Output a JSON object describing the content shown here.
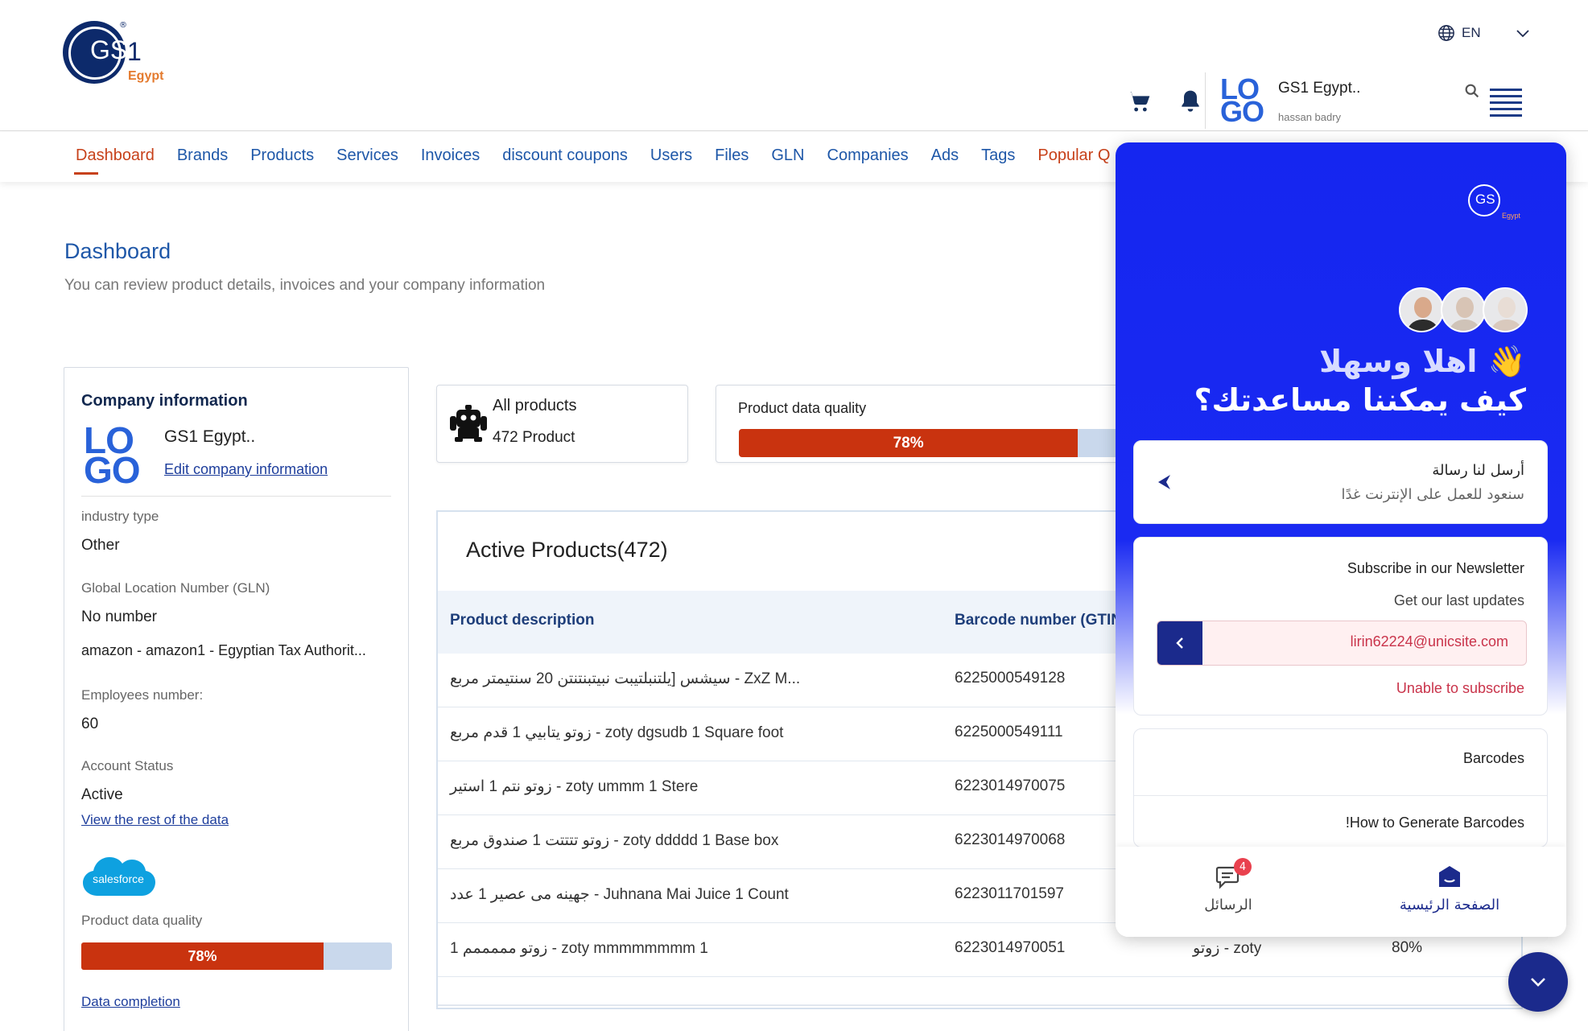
{
  "header": {
    "brand_gs": "GS",
    "brand_one": "1",
    "brand_reg": "®",
    "brand_region": "Egypt",
    "language": "EN",
    "logo_top": "LO",
    "logo_bottom": "GO",
    "user_company": "GS1 Egypt..",
    "user_name": "hassan badry"
  },
  "nav": {
    "items": [
      "Dashboard",
      "Brands",
      "Products",
      "Services",
      "Invoices",
      "discount coupons",
      "Users",
      "Files",
      "GLN",
      "Companies",
      "Ads",
      "Tags",
      "Popular Q"
    ]
  },
  "page": {
    "title": "Dashboard",
    "subtitle": "You can review product details, invoices and your company information"
  },
  "company": {
    "heading": "Company information",
    "name": "GS1 Egypt..",
    "edit_link": "Edit company information",
    "industry_label": "industry type",
    "industry_value": "Other",
    "gln_label": "Global Location Number (GLN)",
    "gln_value": "No number",
    "tax_value": "amazon - amazon1 - Egyptian Tax Authorit...",
    "employees_label": "Employees number:",
    "employees_value": "60",
    "status_label": "Account Status",
    "status_value": "Active",
    "rest_link": "View the rest of the data",
    "salesforce": "salesforce",
    "quality_label": "Product data quality",
    "quality_value": "78%",
    "quality_fraction": 0.78,
    "completion_link": "Data completion"
  },
  "stats": {
    "all_products_label": "All products",
    "all_products_value": "472 Product",
    "quality_label": "Product data quality",
    "quality_value": "78%"
  },
  "products": {
    "title": "Active Products(472)",
    "columns": [
      "Product description",
      "Barcode number (GTIN"
    ],
    "rows": [
      {
        "desc": "سيشس [يلتنبلتيبت نبيتبنتنتن 20 سنتيمتر مربع - ZxZ M...",
        "gtin": "6225000549128",
        "brand": "",
        "quality": ""
      },
      {
        "desc": "زوتو يتابيي 1 قدم مربع - zoty dgsudb 1 Square foot",
        "gtin": "6225000549111",
        "brand": "",
        "quality": ""
      },
      {
        "desc": "زوتو نتم 1 استير - zoty ummm 1 Stere",
        "gtin": "6223014970075",
        "brand": "",
        "quality": ""
      },
      {
        "desc": "زوتو تتتتت 1 صندوق مربع - zoty ddddd 1 Base box",
        "gtin": "6223014970068",
        "brand": "",
        "quality": ""
      },
      {
        "desc": "جهينه مى عصير 1 عدد - Juhnana Mai Juice 1 Count",
        "gtin": "6223011701597",
        "brand": "",
        "quality": ""
      },
      {
        "desc": "زوتو مممممم 1 - zoty mmmmmmmm 1",
        "gtin": "6223014970051",
        "brand": "زوتو - zoty",
        "quality": "80%"
      }
    ]
  },
  "chat": {
    "logo_text": "GS",
    "logo_region": "Egypt",
    "greeting": "اهلا وسهلا 👋",
    "question": "كيف يمكننا مساعدتك؟",
    "message_title": "أرسل لنا رسالة",
    "message_sub": "سنعود للعمل على الإنترنت غدًا",
    "newsletter_title": "Subscribe in our Newsletter",
    "newsletter_sub": "Get our last updates",
    "newsletter_email": "lirin62224@unicsite.com",
    "newsletter_error": "Unable to subscribe",
    "barcodes_title": "Barcodes",
    "barcodes_item": "!How to Generate Barcodes",
    "tab_home": "الصفحة الرئيسية",
    "tab_messages": "الرسائل",
    "unread_count": "4"
  },
  "colors": {
    "accent": "#c7411a",
    "link": "#1e57a8",
    "chat_blue": "#1526f0",
    "navy": "#1b2a8c"
  }
}
